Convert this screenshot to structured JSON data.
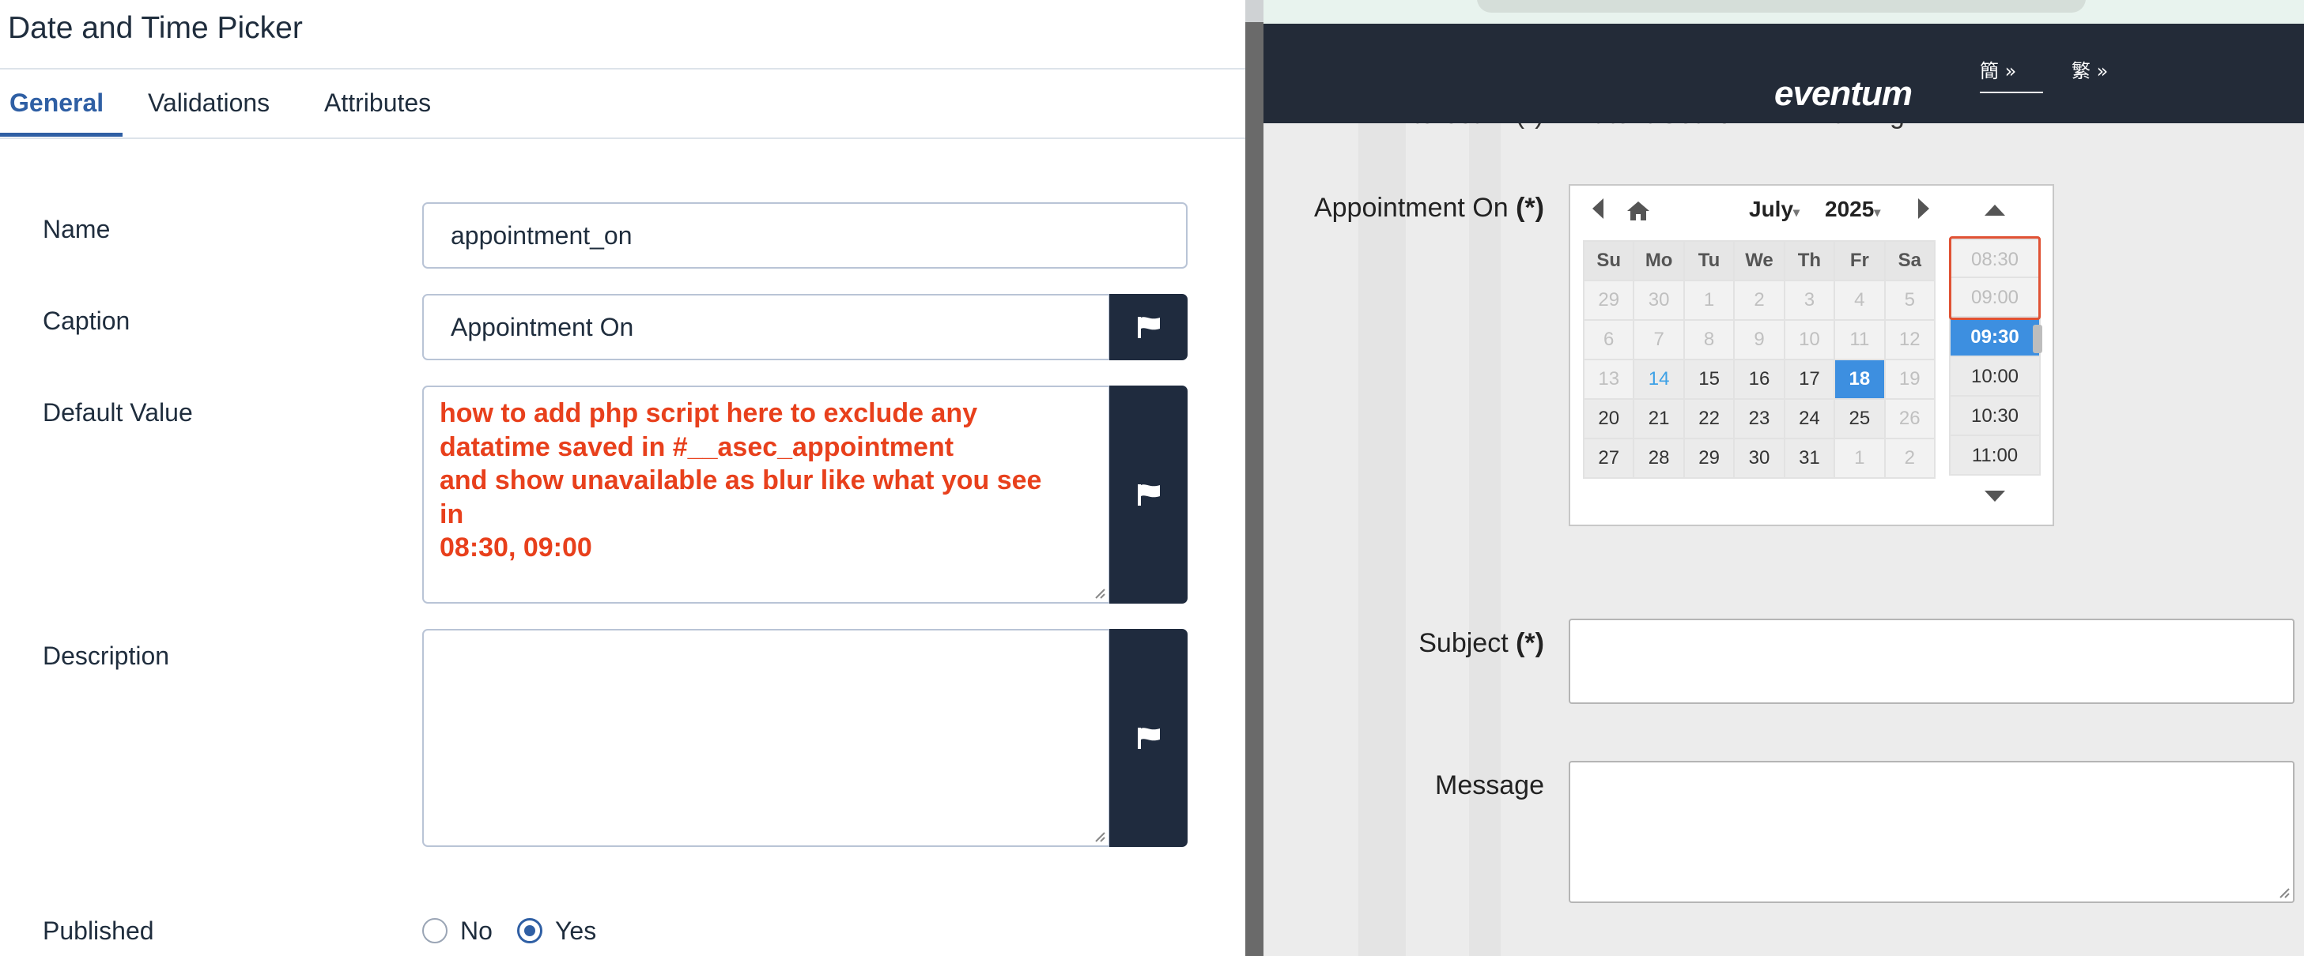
{
  "left_panel": {
    "title": "Date and Time Picker",
    "tabs": [
      "General",
      "Validations",
      "Attributes"
    ],
    "fields": {
      "name": {
        "label": "Name",
        "value": "appointment_on"
      },
      "caption": {
        "label": "Caption",
        "value": "Appointment On"
      },
      "default_value": {
        "label": "Default Value",
        "value": "how to add php script here to exclude any\ndatatime saved in #__asec_appointment\nand show unavailable as blur like what you see\nin\n08:30, 09:00"
      },
      "description": {
        "label": "Description",
        "value": ""
      },
      "published": {
        "label": "Published",
        "options": [
          "No",
          "Yes"
        ],
        "selected": "Yes"
      }
    }
  },
  "right_panel": {
    "logo": "eventum",
    "languages": [
      "簡 »",
      "繁 »"
    ],
    "partial_row": "Interest in (*)   □ Patent Search  □ IP Training",
    "appointment_label": "Appointment On",
    "required_mark": "(*)",
    "subject_label": "Subject",
    "message_label": "Message",
    "datepicker": {
      "month": "July",
      "year": "2025",
      "weekdays": [
        "Su",
        "Mo",
        "Tu",
        "We",
        "Th",
        "Fr",
        "Sa"
      ],
      "weeks": [
        [
          "29",
          "30",
          "1",
          "2",
          "3",
          "4",
          "5"
        ],
        [
          "6",
          "7",
          "8",
          "9",
          "10",
          "11",
          "12"
        ],
        [
          "13",
          "14",
          "15",
          "16",
          "17",
          "18",
          "19"
        ],
        [
          "20",
          "21",
          "22",
          "23",
          "24",
          "25",
          "26"
        ],
        [
          "27",
          "28",
          "29",
          "30",
          "31",
          "1",
          "2"
        ]
      ],
      "times": [
        "08:30",
        "09:00",
        "09:30",
        "10:00",
        "10:30",
        "11:00"
      ],
      "selected_day": "18",
      "today": "14",
      "selected_time": "09:30",
      "unavailable_times": [
        "08:30",
        "09:00"
      ]
    }
  },
  "colors": {
    "accent_blue": "#2f5fa4",
    "annotation_red": "#e8401c",
    "navbar_dark": "#232b38",
    "flag_button": "#1f2b3e",
    "picker_selected": "#3d8fe0"
  }
}
